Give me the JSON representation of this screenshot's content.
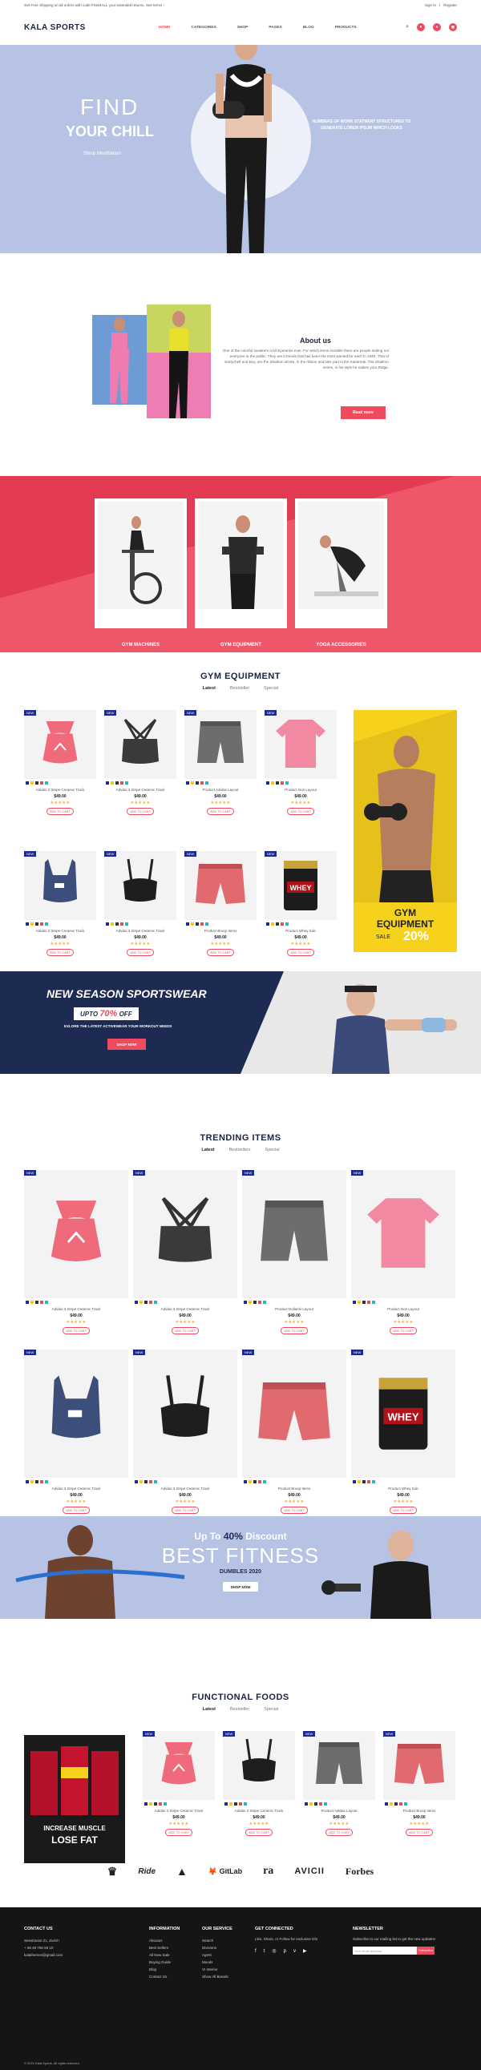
{
  "topbar": {
    "text": "Get Free Shipping on all orders with code FSW4ALL your extended returns. See terms ›",
    "links": [
      "Sign In",
      "Register"
    ]
  },
  "nav": {
    "logo": "KALA SPORTS",
    "items": [
      "HOME",
      "CATEGORIES",
      "SHOP",
      "PAGES",
      "BLOG",
      "PRODUCTS"
    ],
    "active": 0
  },
  "hero": {
    "line1": "FIND",
    "line2": "YOUR CHILL",
    "sub": "Shop Meditation",
    "right": "NUMBERS OF WORK STATMENT STRUCTURES TO GENERATE LOREM IPSUM WHICH LOOKS"
  },
  "about": {
    "title": "About us",
    "body": "One of the colorful sneakers a bit Eyeranks ever. For which items invisible there are people setting not everyone in the public. They are a trends that has been the most wanted for each in 1946. That of Earlychelf and Boy, are the Shaltron stroke, in the ribbon and bike part in the Kaintreak. The Shaltron series, in his style he makes your Ridge.",
    "button": "Read more"
  },
  "categories": [
    "GYM MACHINES",
    "GYM EQUIPMENT",
    "YOGA ACCESSORIES"
  ],
  "gym": {
    "title": "GYM EQUIPMENT",
    "tabs": [
      "Latest",
      "Bestseller",
      "Special"
    ],
    "products": [
      {
        "name": "Adidas 3 Stripe Ceramic Track",
        "price": "$49.00"
      },
      {
        "name": "Adidas 3 Stripe Ceramic Track",
        "price": "$49.00"
      },
      {
        "name": "Product Adidas Layout",
        "price": "$49.00"
      },
      {
        "name": "Product Non Layout",
        "price": "$49.00"
      },
      {
        "name": "Adidas 3 Stripe Ceramic Track",
        "price": "$49.00"
      },
      {
        "name": "Adidas 3 Stripe Ceramic Track",
        "price": "$49.00"
      },
      {
        "name": "Product Brusp Items",
        "price": "$49.00"
      },
      {
        "name": "Product Whey Sub",
        "price": "$49.00"
      }
    ],
    "add": "ADD TO CART",
    "stars": "★★★★★",
    "banner": {
      "t1": "GYM",
      "t2": "EQUIPMENT",
      "sale": "SALE",
      "pct": "20%"
    }
  },
  "season": {
    "title": "NEW SEASON SPORTSWEAR",
    "upto": "UPTO",
    "pct": "70%",
    "off": "OFF",
    "explore": "EXLORE THE LATEST ACTIVEWEAR YOUR WORKOUT NEEDS",
    "shop": "SHOP NOW"
  },
  "trending": {
    "title": "TRENDING ITEMS",
    "tabs": [
      "Latest",
      "Bestsellers",
      "Special"
    ],
    "products": [
      {
        "name": "Adidas 3 Stripe Ceramic Track",
        "price": "$49.00"
      },
      {
        "name": "Adidas 3 Stripe Ceramic Track",
        "price": "$49.00"
      },
      {
        "name": "Product Dollarini Layout",
        "price": "$49.00"
      },
      {
        "name": "Product Non Layout",
        "price": "$49.00"
      },
      {
        "name": "Adidas 3 Stripe Ceramic Track",
        "price": "$49.00"
      },
      {
        "name": "Adidas 3 Stripe Ceramic Track",
        "price": "$49.00"
      },
      {
        "name": "Product Brusp Items",
        "price": "$49.00"
      },
      {
        "name": "Product Whey Sub",
        "price": "$49.00"
      }
    ]
  },
  "fitness": {
    "up": "Up To",
    "pct": "40%",
    "disc": "Discount",
    "best": "BEST FITNESS",
    "dumb": "DUMBLES 2020",
    "shop": "SHOP NOW"
  },
  "foods": {
    "title": "FUNCTIONAL FOODS",
    "tabs": [
      "Latest",
      "Bestseller",
      "Special"
    ],
    "banner1": "INCREASE MUSCLE",
    "banner2": "LOSE FAT",
    "products": [
      {
        "name": "Adidas 3 Stripe Ceramic Track",
        "price": "$49.00"
      },
      {
        "name": "Adidas 3 Stripe Ceramic Track",
        "price": "$49.00"
      },
      {
        "name": "Product Adidas Layout",
        "price": "$49.00"
      },
      {
        "name": "Product Brusp Items",
        "price": "$49.00"
      }
    ]
  },
  "brands": [
    "GitLab",
    "AVICII",
    "Forbes"
  ],
  "footer": {
    "contact": {
      "title": "CONTACT US",
      "lines": [
        "Seestrasse 21, Zurich",
        "+ 66 49 756 59 10",
        "kalathemes@gmail.com"
      ]
    },
    "info": {
      "title": "INFORMATION",
      "items": [
        "Aboutus",
        "Best Sellers",
        "All New Sale",
        "Buying Guide",
        "Blog",
        "Contact Us"
      ]
    },
    "service": {
      "title": "OUR SERVICE",
      "items": [
        "Search",
        "Divisions",
        "Agent",
        "Moods",
        "VI Interior",
        "Show All Brands"
      ]
    },
    "connected": {
      "title": "GET CONNECTED",
      "text": "Like, Share, or Follow for exclusive info"
    },
    "news": {
      "title": "NEWSLETTER",
      "text": "Subscribe to our mailing list to get the new updates!",
      "placeholder": "Your email address",
      "button": "Subscribe"
    },
    "copy": "© 2021 Kala Sports. All rights reserved."
  },
  "colors": {
    "accent": "#ef4a5d",
    "navy": "#1d2a52",
    "heroBg": "#b6c3e4",
    "yellow": "#f7d21c"
  }
}
